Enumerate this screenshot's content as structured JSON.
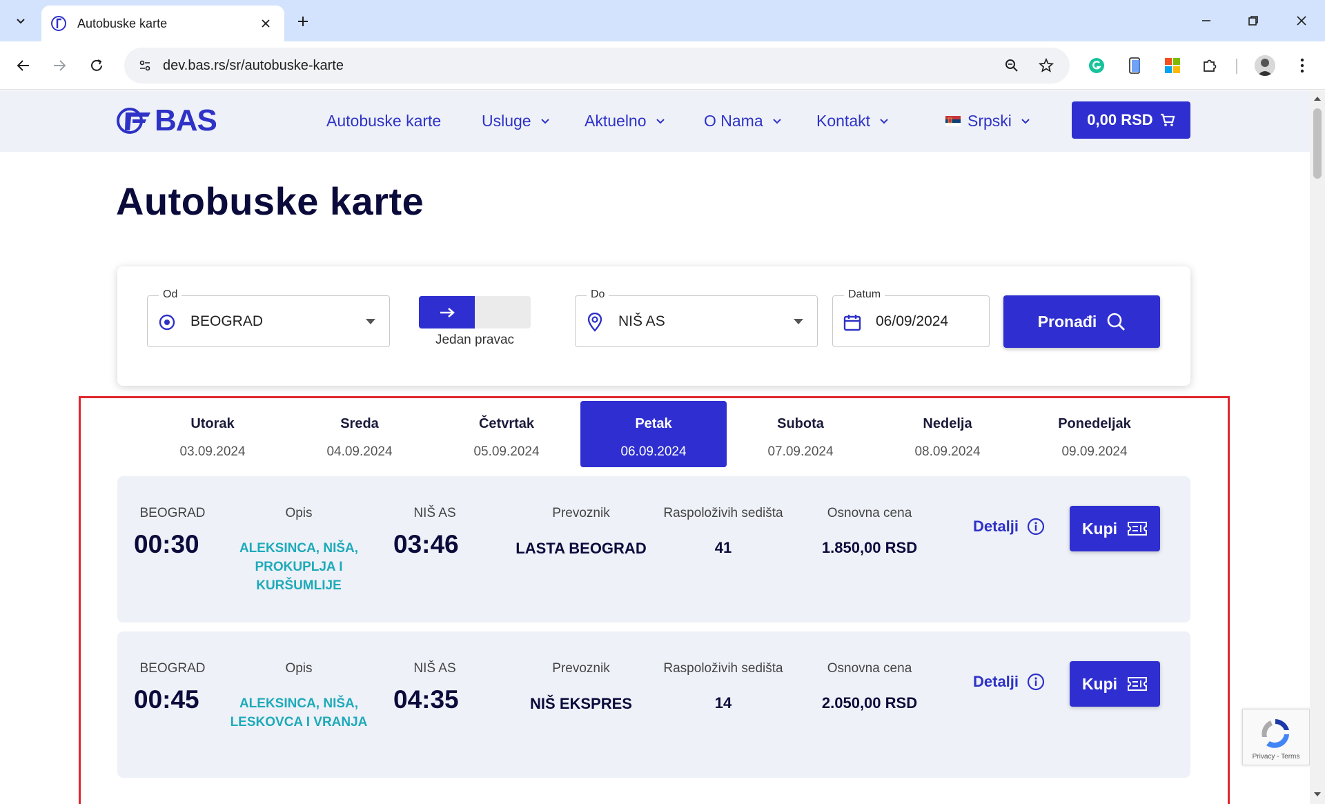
{
  "browser": {
    "tab_title": "Autobuske karte",
    "url": "dev.bas.rs/sr/autobuske-karte"
  },
  "header": {
    "logo_text": "BAS",
    "nav": [
      {
        "label": "Autobuske karte"
      },
      {
        "label": "Usluge"
      },
      {
        "label": "Aktuelno"
      },
      {
        "label": "O Nama"
      },
      {
        "label": "Kontakt"
      }
    ],
    "language": "Srpski",
    "cart_label": "0,00 RSD"
  },
  "page": {
    "title": "Autobuske karte"
  },
  "search": {
    "from_label": "Od",
    "from_value": "BEOGRAD",
    "direction_label": "Jedan pravac",
    "to_label": "Do",
    "to_value": "NIŠ AS",
    "date_label": "Datum",
    "date_value": "06/09/2024",
    "button_label": "Pronađi"
  },
  "days": [
    {
      "name": "Utorak",
      "date": "03.09.2024"
    },
    {
      "name": "Sreda",
      "date": "04.09.2024"
    },
    {
      "name": "Četvrtak",
      "date": "05.09.2024"
    },
    {
      "name": "Petak",
      "date": "06.09.2024"
    },
    {
      "name": "Subota",
      "date": "07.09.2024"
    },
    {
      "name": "Nedelja",
      "date": "08.09.2024"
    },
    {
      "name": "Ponedeljak",
      "date": "09.09.2024"
    }
  ],
  "active_day": "Petak",
  "trip_labels": {
    "route_label": "Opis",
    "carrier_label": "Prevoznik",
    "seats_label": "Raspoloživih sedišta",
    "price_label": "Osnovna cena",
    "details_label": "Detalji",
    "buy_label": "Kupi"
  },
  "trips": [
    {
      "from": "BEOGRAD",
      "departure": "00:30",
      "route": "ALEKSINCA, NIŠA, PROKUPLJA I KURŠUMLIJE",
      "to": "NIŠ AS",
      "arrival": "03:46",
      "carrier": "LASTA BEOGRAD",
      "seats": "41",
      "price": "1.850,00 RSD"
    },
    {
      "from": "BEOGRAD",
      "departure": "00:45",
      "route": "ALEKSINCA, NIŠA, LESKOVCA I VRANJA",
      "to": "NIŠ AS",
      "arrival": "04:35",
      "carrier": "NIŠ EKSPRES",
      "seats": "14",
      "price": "2.050,00 RSD"
    }
  ],
  "recaptcha": {
    "links": "Privacy - Terms"
  },
  "colors": {
    "brand": "#2f2fd1",
    "route_text": "#1eaab9",
    "highlight": "#e0262c"
  }
}
